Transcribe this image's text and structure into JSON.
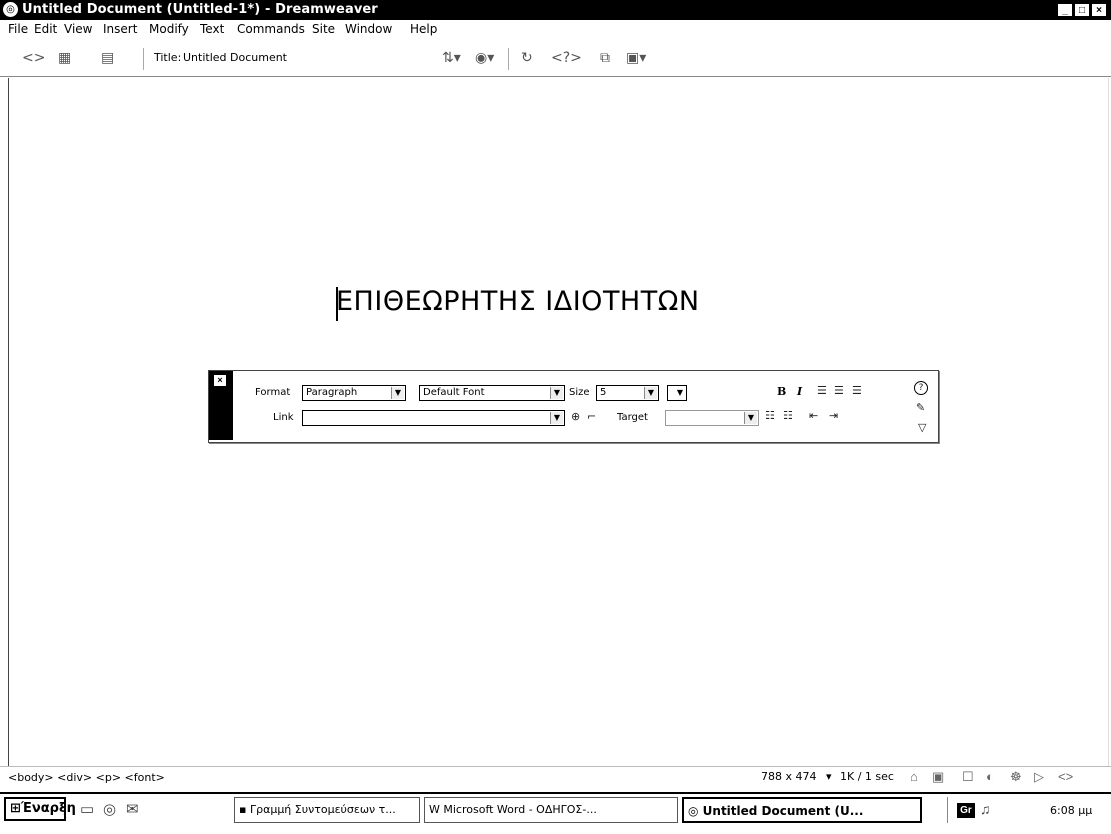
{
  "window": {
    "title": "Untitled Document (Untitled-1*) - Dreamweaver",
    "controls": [
      "_",
      "□",
      "×"
    ]
  },
  "menu": [
    {
      "name": "menu-file",
      "label": "File"
    },
    {
      "name": "menu-edit",
      "label": "Edit"
    },
    {
      "name": "menu-view",
      "label": "View"
    },
    {
      "name": "menu-insert",
      "label": "Insert"
    },
    {
      "name": "menu-modify",
      "label": "Modify"
    },
    {
      "name": "menu-text",
      "label": "Text"
    },
    {
      "name": "menu-commands",
      "label": "Commands"
    },
    {
      "name": "menu-site",
      "label": "Site"
    },
    {
      "name": "menu-window",
      "label": "Window"
    },
    {
      "name": "menu-help",
      "label": "Help"
    }
  ],
  "toolbar": {
    "title_label": "Title:",
    "title_value": "Untitled Document"
  },
  "document": {
    "heading": "ΕΠΙΘΕΩΡΗΤΗΣ ΙΔΙΟΤΗΤΩΝ"
  },
  "properties": {
    "format_label": "Format",
    "format_value": "Paragraph",
    "font_value": "Default Font",
    "size_label": "Size",
    "size_value": "5",
    "link_label": "Link",
    "link_value": "",
    "target_label": "Target",
    "target_value": "",
    "bold_label": "B",
    "italic_label": "I",
    "help_label": "?"
  },
  "status": {
    "tag_selector": "<body> <div> <p> <font>",
    "window_size": "788 x 474",
    "download": "1K / 1 sec"
  },
  "taskbar": {
    "start_label": "Έναρξη",
    "tasks": [
      {
        "label": "Γραμμή Συντομεύσεων τ..."
      },
      {
        "label": "Microsoft Word - ΟΔΗΓΟΣ-..."
      },
      {
        "label": "Untitled Document (U..."
      }
    ],
    "tray_label": "Gr",
    "clock": "6:08 μμ"
  }
}
